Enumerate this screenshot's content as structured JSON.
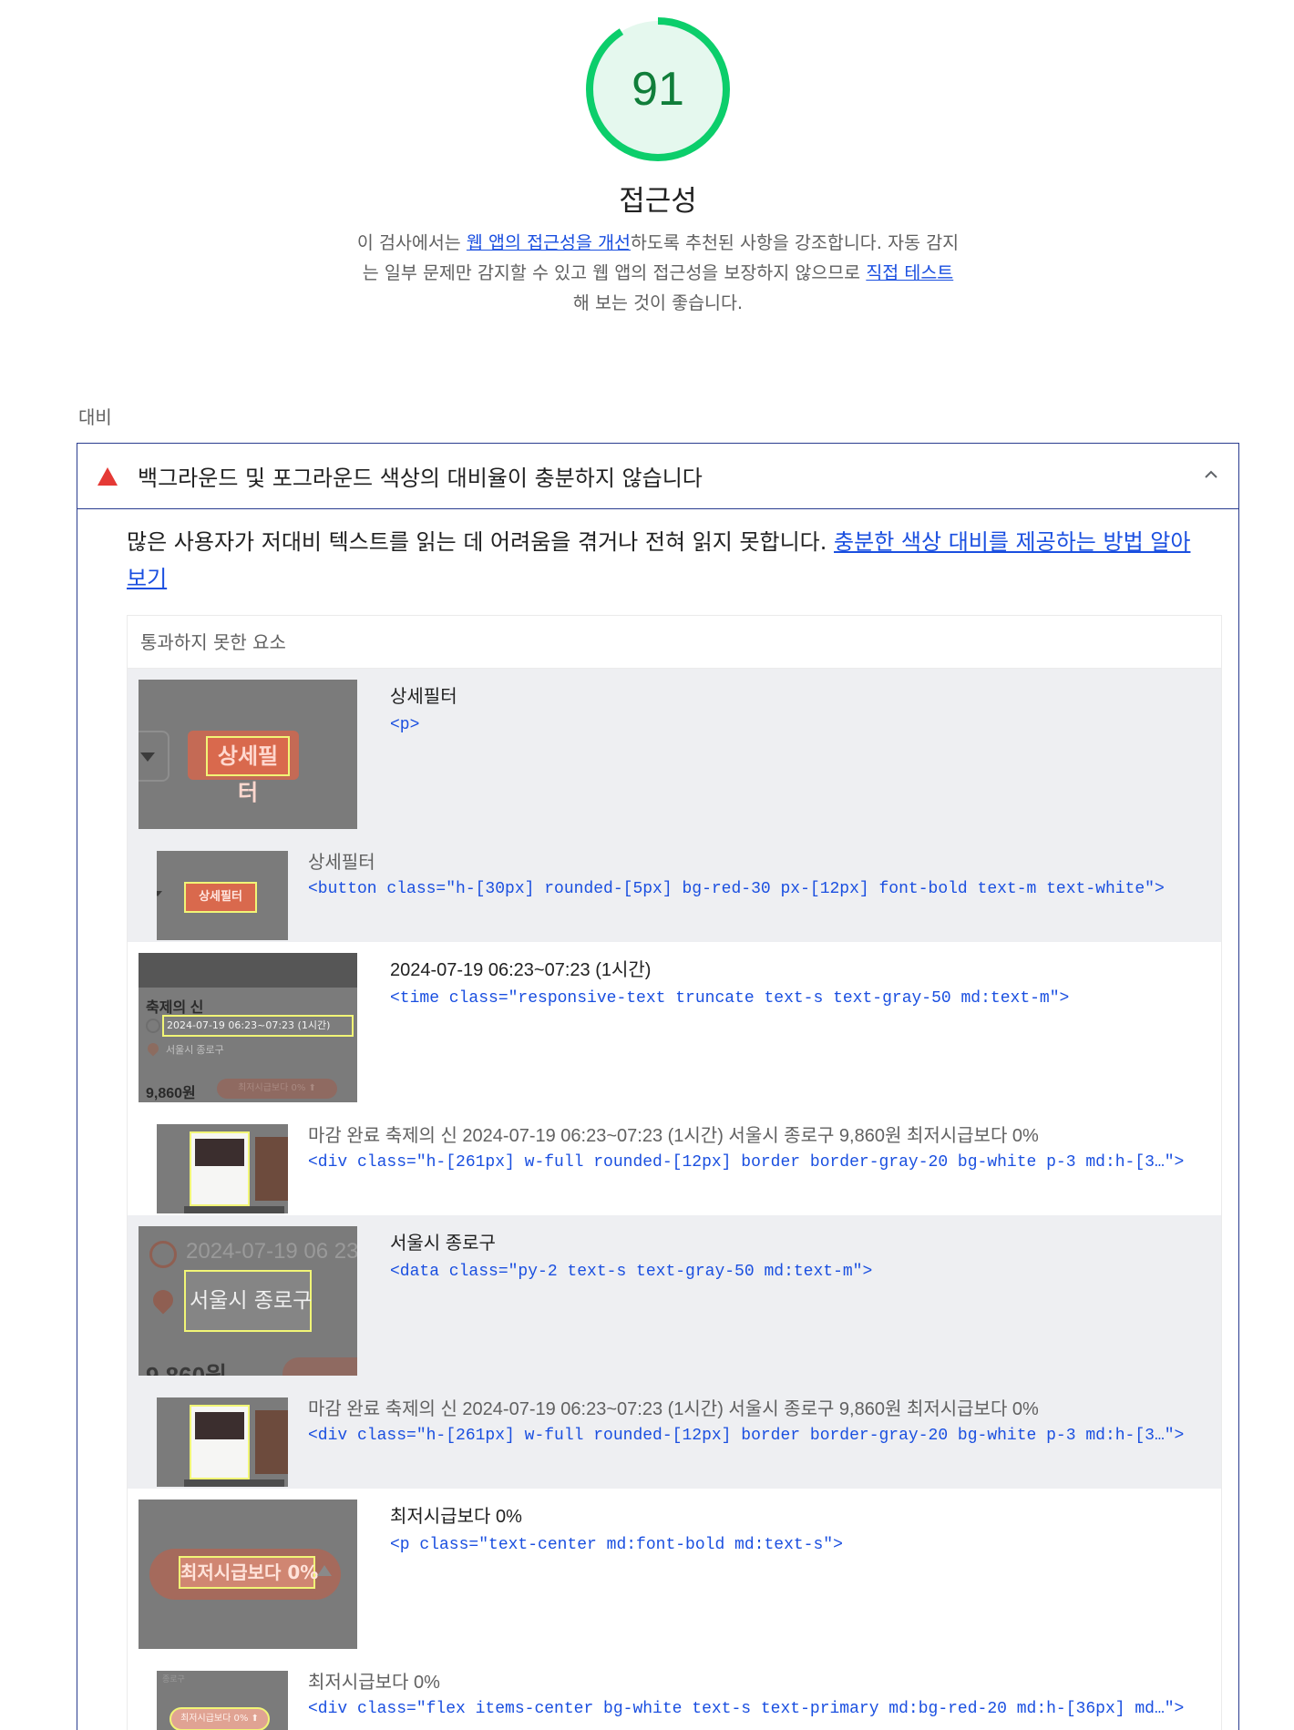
{
  "score": {
    "value": "91",
    "color": "#0cce6b",
    "text_color": "#107e3a",
    "fraction": 0.91
  },
  "category": {
    "title": "접근성",
    "desc_prefix": "이 검사에서는 ",
    "desc_link1": "웹 앱의 접근성을 개선",
    "desc_middle": "하도록 추천된 사항을 강조합니다. 자동 감지는 일부 문제만 감지할 수 있고 웹 앱의 접근성을 보장하지 않으므로 ",
    "desc_link2": "직접 테스트",
    "desc_suffix": "해 보는 것이 좋습니다."
  },
  "group": {
    "label": "대비"
  },
  "audit": {
    "status_icon": "fail-triangle-icon",
    "title": "백그라운드 및 포그라운드 색상의 대비율이 충분하지 않습니다",
    "chevron_icon": "chevron-up-icon",
    "desc_text": "많은 사용자가 저대비 텍스트를 읽는 데 어려움을 겪거나 전혀 읽지 못합니다. ",
    "desc_link": "충분한 색상 대비를 제공하는 방법 알아보기",
    "table_header": "통과하지 못한 요소",
    "items": [
      {
        "label": "상세필터",
        "code": "<p>",
        "sub_label": "상세필터",
        "sub_code": "<button class=\"h-[30px] rounded-[5px] bg-red-30 px-[12px] font-bold text-m text-white\">",
        "thumb_text": "상세필터"
      },
      {
        "label": "2024-07-19 06:23~07:23 (1시간)",
        "code": "<time class=\"responsive-text truncate text-s text-gray-50 md:text-m\">",
        "sub_label": "마감 완료 축제의 신 2024-07-19 06:23~07:23 (1시간) 서울시 종로구 9,860원 최저시급보다 0%",
        "sub_code": "<div class=\"h-[261px] w-full rounded-[12px] border border-gray-20 bg-white p-3 md:h-[3…\">",
        "thumb_title": "축제의 신",
        "thumb_time": "2024-07-19 06:23~07:23 (1시간)",
        "thumb_place": "서울시 종로구",
        "thumb_price": "9,860원",
        "thumb_badge": "최저시급보다 0% ⬆"
      },
      {
        "label": "서울시 종로구",
        "code": "<data class=\"py-2 text-s text-gray-50 md:text-m\">",
        "sub_label": "마감 완료 축제의 신 2024-07-19 06:23~07:23 (1시간) 서울시 종로구 9,860원 최저시급보다 0%",
        "sub_code": "<div class=\"h-[261px] w-full rounded-[12px] border border-gray-20 bg-white p-3 md:h-[3…\">",
        "thumb_time": "2024-07-19 06 23",
        "thumb_place": "서울시 종로구",
        "thumb_price": "9,860원"
      },
      {
        "label": "최저시급보다 0%",
        "code": "<p class=\"text-center md:font-bold md:text-s\">",
        "sub_label": "최저시급보다 0%",
        "sub_code": "<div class=\"flex items-center bg-white text-s text-primary md:bg-red-20 md:h-[36px] md…\">",
        "thumb_text": "최저시급보다 0%",
        "sub_thumb_text": "최저시급보다 0% ⬆",
        "sub_thumb_small": "종로구"
      }
    ]
  }
}
